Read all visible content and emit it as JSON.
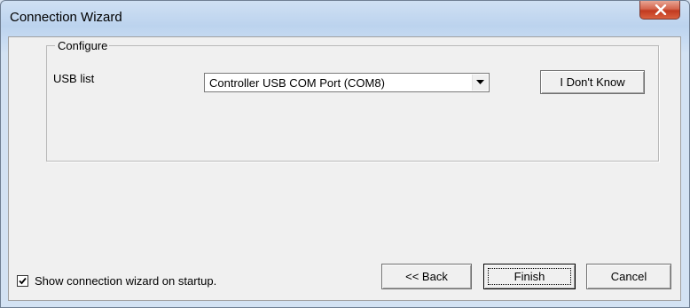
{
  "window": {
    "title": "Connection Wizard"
  },
  "icons": {
    "close": "close-icon",
    "dropdown": "chevron-down-icon",
    "check": "check-icon"
  },
  "colors": {
    "titlebar": "#bcd3ee",
    "close_button": "#c7432a",
    "client": "#f0f0f0"
  },
  "group": {
    "label": "Configure"
  },
  "usb": {
    "label": "USB list",
    "selected": "Controller USB COM Port (COM8)",
    "dont_know_label": "I Don't Know"
  },
  "footer": {
    "show_on_startup_label": "Show connection wizard on startup.",
    "show_on_startup_checked": true,
    "back_label": "<< Back",
    "finish_label": "Finish",
    "cancel_label": "Cancel"
  }
}
